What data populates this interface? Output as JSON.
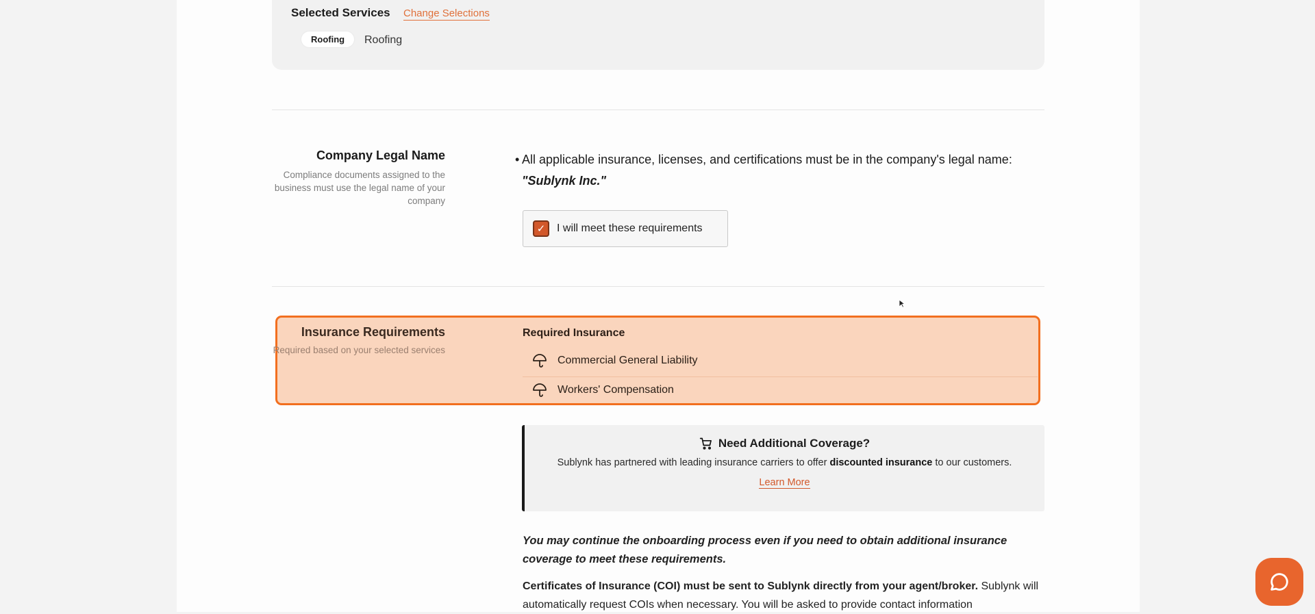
{
  "services": {
    "title": "Selected Services",
    "change_link": "Change Selections",
    "chip": "Roofing",
    "chip_text": "Roofing"
  },
  "legal_name": {
    "title": "Company Legal Name",
    "description": "Compliance documents assigned to the business must use the legal name of your company",
    "bullet_prefix": "All applicable insurance, licenses, and certifications must be in the company's legal name: ",
    "company": "\"Sublynk Inc.\"",
    "confirm_label": "I will meet these requirements",
    "confirm_checked": true
  },
  "insurance": {
    "title": "Insurance Requirements",
    "description": "Required based on your selected services",
    "required_title": "Required Insurance",
    "items": [
      "Commercial General Liability",
      "Workers' Compensation"
    ]
  },
  "promo": {
    "title": "Need Additional Coverage?",
    "text_before": "Sublynk has partnered with leading insurance carriers to offer ",
    "text_bold": "discounted insurance",
    "text_after": " to our customers.",
    "link": "Learn More"
  },
  "note": "You may continue the onboarding process even if you need to obtain additional insurance coverage to meet these requirements.",
  "coi": {
    "bold": "Certificates of Insurance (COI) must be sent to Sublynk directly from your agent/broker.",
    "rest": " Sublynk will automatically request COIs when necessary. You will be asked to provide contact information"
  },
  "colors": {
    "accent": "#e8652d",
    "highlight_border": "#f26f1f",
    "highlight_bg": "#fad5bd"
  },
  "icons": [
    "umbrella-icon",
    "cart-icon",
    "chat-icon",
    "check-icon"
  ]
}
